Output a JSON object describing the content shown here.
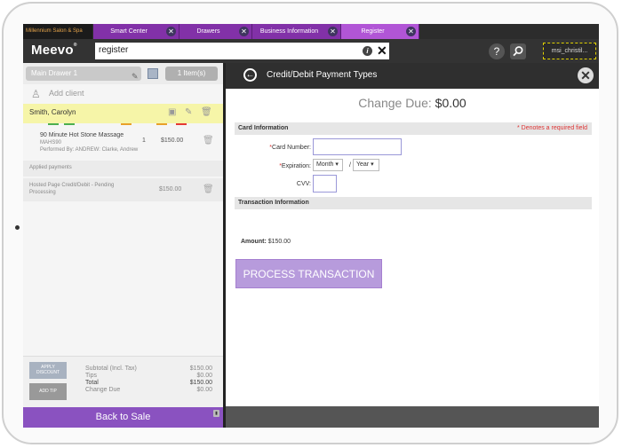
{
  "app": {
    "salon_name": "Millennium Salon & Spa",
    "logo": "Meevo",
    "logo_mark": "®",
    "tabs": [
      {
        "label": "Smart Center"
      },
      {
        "label": "Drawers"
      },
      {
        "label": "Business Information"
      },
      {
        "label": "Register"
      }
    ],
    "close_glyph": "✕",
    "search_value": "register",
    "info_glyph": "i",
    "clear_glyph": "✕",
    "help_glyph": "?",
    "user_label": "msi_christil..."
  },
  "register": {
    "drawer_label": "Main Drawer 1",
    "items_count": "1 Item(s)",
    "add_client": "Add client",
    "client_name": "Smith, Carolyn",
    "service": {
      "name": "90 Minute Hot Stone Massage",
      "code": "MAHS90",
      "performed_by": "Performed By: ANDREW: Clarke, Andrew",
      "qty": "1",
      "price": "$150.00"
    },
    "applied_payments_label": "Applied payments",
    "payment": {
      "name": "Hosted Page Credit/Debit - Pending Processing",
      "amount": "$150.00"
    },
    "apply_discount": "APPLY DISCOUNT",
    "add_tip": "ADD TIP",
    "totals": [
      {
        "label": "Subtotal (Incl. Tax)",
        "value": "$150.00"
      },
      {
        "label": "Tips",
        "value": "$0.00"
      },
      {
        "label": "Total",
        "value": "$150.00"
      },
      {
        "label": "Change Due",
        "value": "$0.00"
      }
    ],
    "back_to_sale": "Back to Sale",
    "status_colors": [
      "#4caf50",
      "#4caf50",
      "#e8a02a",
      "#e8a02a",
      "#e53935"
    ]
  },
  "payment_panel": {
    "title": "Credit/Debit Payment Types",
    "change_due_label": "Change Due:",
    "change_due_value": "$0.00",
    "card_info_header": "Card Information",
    "required_note": "* Denotes a required field",
    "card_number_label": "Card Number:",
    "expiration_label": "Expiration:",
    "month_value": "Month",
    "year_value": "Year",
    "date_separator": "/",
    "cvv_label": "CVV:",
    "transaction_header": "Transaction Information",
    "amount_label": "Amount:",
    "amount_value": "$150.00",
    "process_button": "PROCESS TRANSACTION",
    "accent_color": "#b79bdc"
  }
}
